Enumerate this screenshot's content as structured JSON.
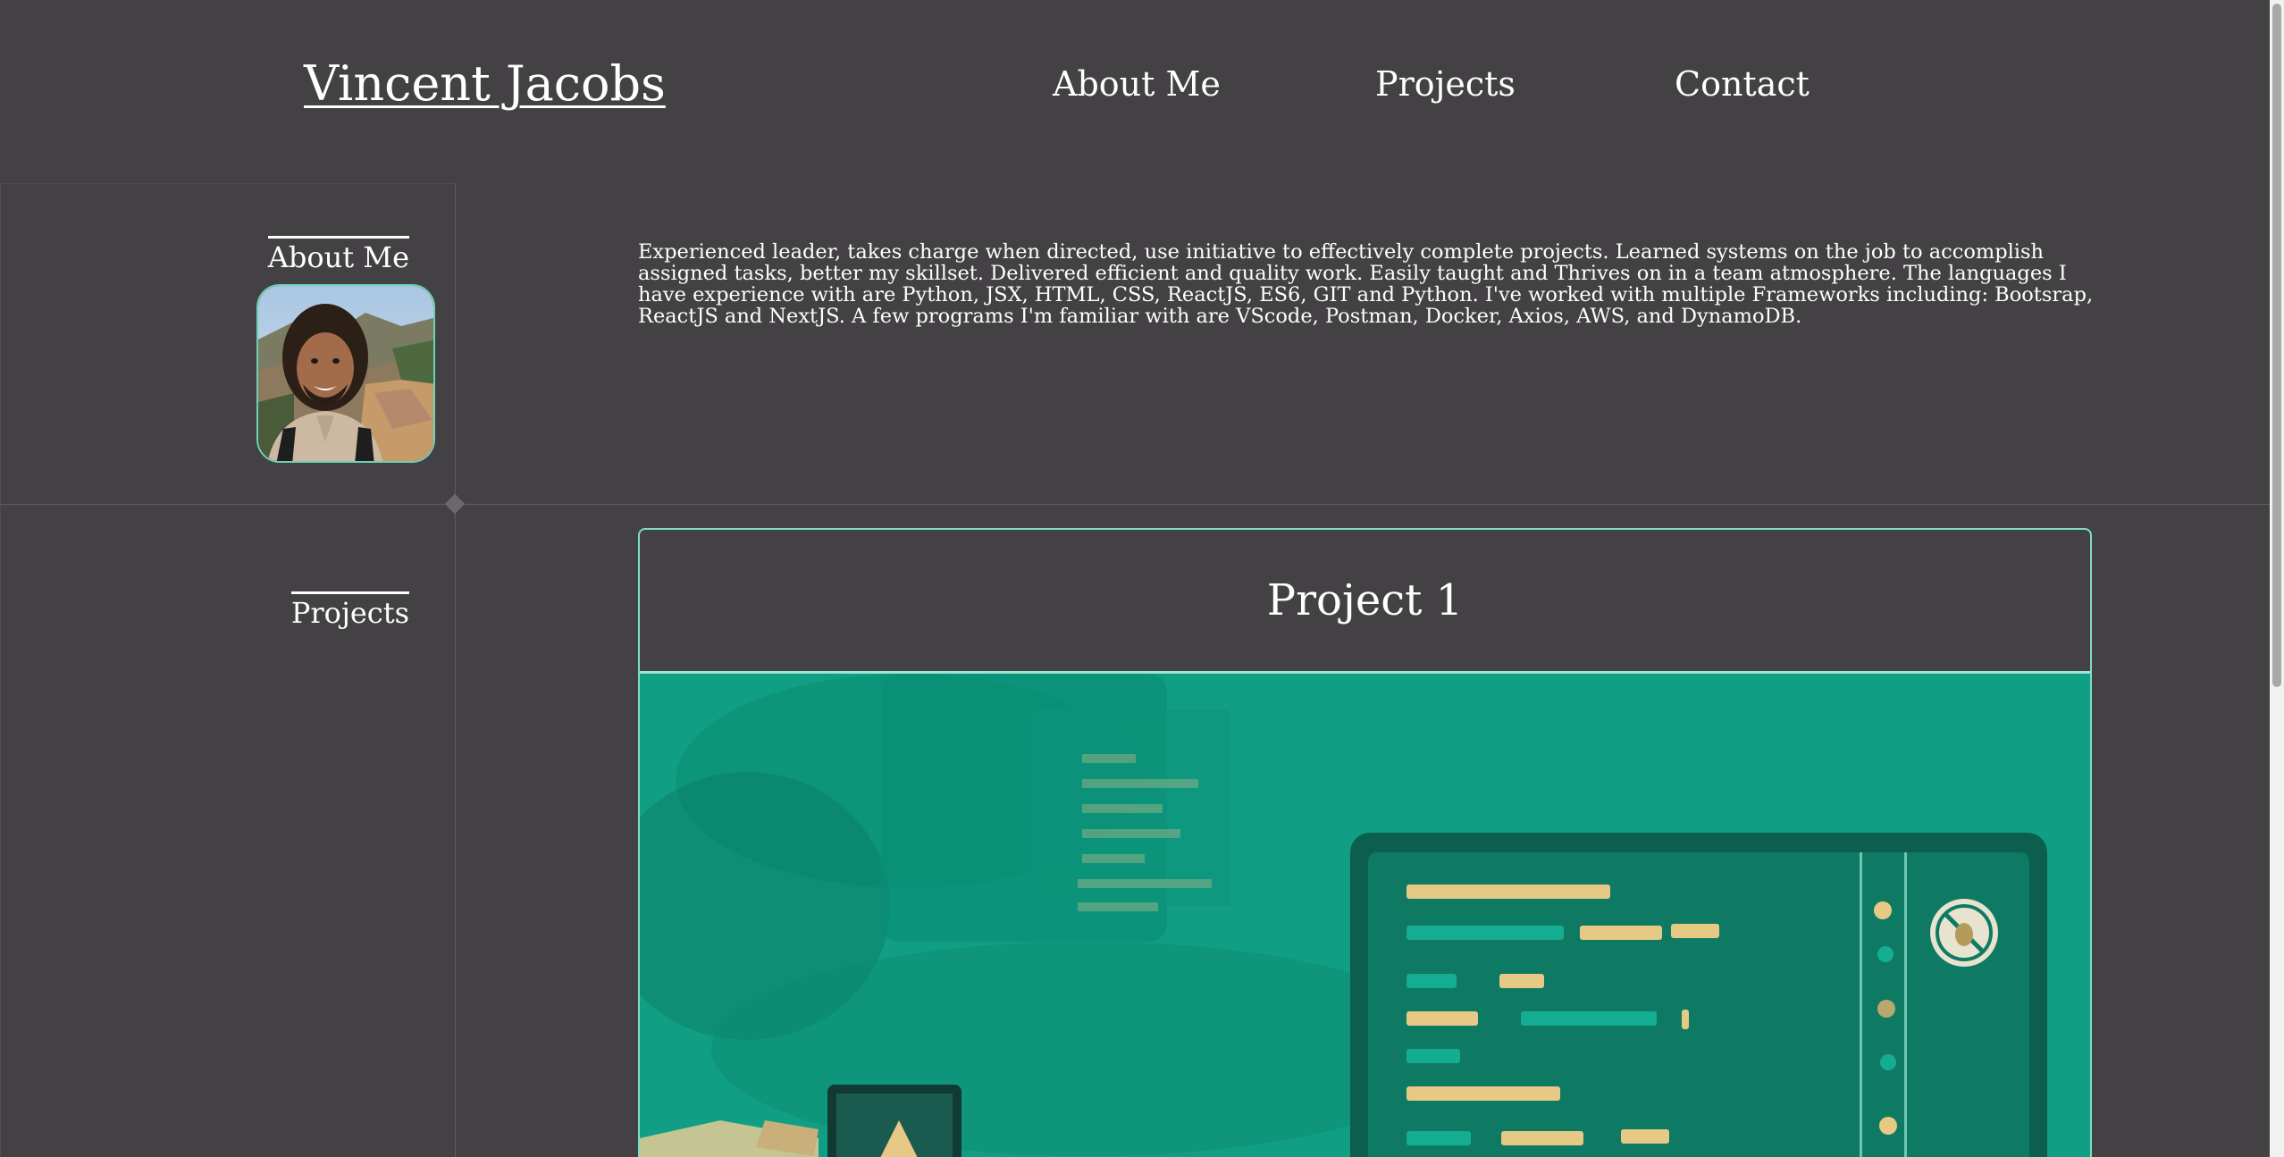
{
  "header": {
    "title": "Vincent Jacobs",
    "nav": [
      {
        "label": "About Me"
      },
      {
        "label": "Projects"
      },
      {
        "label": "Contact"
      }
    ]
  },
  "about": {
    "label": "About Me",
    "avatar_alt": "Vincent Jacobs portrait",
    "text": "Experienced leader, takes charge when directed, use initiative to effectively complete projects. Learned systems on the job to accomplish assigned tasks, better my skillset. Delivered efficient and quality work. Easily taught and Thrives on in a team atmosphere. The languages I have experience with are Python, JSX, HTML, CSS, ReactJS, ES6, GIT and Python. I've worked with multiple Frameworks including: Bootsrap, ReactJS and NextJS. A few programs I'm familiar with are VScode, Postman, Docker, Axios, AWS, and DynamoDB."
  },
  "projects": {
    "label": "Projects",
    "items": [
      {
        "title": "Project 1"
      }
    ]
  },
  "colors": {
    "background": "#434143",
    "accent": "#7fdcc2",
    "project_image_bg": "#0f9a80"
  }
}
